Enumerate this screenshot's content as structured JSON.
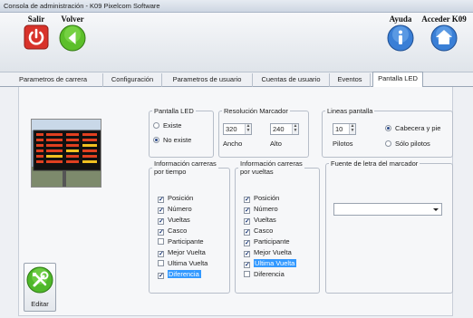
{
  "window": {
    "title": "Consola de administración - K09 Pixelcom Software"
  },
  "toolbar": {
    "salir": "Salir",
    "volver": "Volver",
    "ayuda": "Ayuda",
    "acceder": "Acceder K09"
  },
  "tabs": [
    {
      "label": "Parametros de carrera"
    },
    {
      "label": "Configuración"
    },
    {
      "label": "Parametros de usuario"
    },
    {
      "label": "Cuentas de usuario"
    },
    {
      "label": "Eventos"
    },
    {
      "label": "Pantalla LED",
      "active": true
    }
  ],
  "pantalla_led": {
    "legend": "Pantalla LED",
    "options": [
      "Existe",
      "No existe"
    ],
    "selected": "No existe"
  },
  "resolucion": {
    "legend": "Resolución Marcador",
    "ancho_value": "320",
    "alto_value": "240",
    "ancho_label": "Ancho",
    "alto_label": "Alto"
  },
  "lineas": {
    "legend": "Lineas pantalla",
    "value": "10",
    "pilotos_label": "Pilotos",
    "options": [
      "Cabecera y pie",
      "Sólo pilotos"
    ],
    "selected": "Cabecera y pie"
  },
  "info_tiempo": {
    "legend_line1": "Información carreras",
    "legend_line2": "por tiempo",
    "items": [
      {
        "label": "Posición",
        "checked": true
      },
      {
        "label": "Número",
        "checked": true
      },
      {
        "label": "Vueltas",
        "checked": true
      },
      {
        "label": "Casco",
        "checked": true
      },
      {
        "label": "Participante",
        "checked": false
      },
      {
        "label": "Mejor Vuelta",
        "checked": true
      },
      {
        "label": "Ultima Vuelta",
        "checked": false
      },
      {
        "label": "Diferencia",
        "checked": true,
        "selected": true
      }
    ]
  },
  "info_vueltas": {
    "legend_line1": "Información carreras",
    "legend_line2": "por vueltas",
    "items": [
      {
        "label": "Posición",
        "checked": true
      },
      {
        "label": "Número",
        "checked": true
      },
      {
        "label": "Vueltas",
        "checked": true
      },
      {
        "label": "Casco",
        "checked": true
      },
      {
        "label": "Participante",
        "checked": true
      },
      {
        "label": "Mejor Vuelta",
        "checked": true
      },
      {
        "label": "Ultima Vuelta",
        "checked": true,
        "selected": true
      },
      {
        "label": "Diferencia",
        "checked": false
      }
    ]
  },
  "fuente": {
    "legend": "Fuente de letra del marcador",
    "value": ""
  },
  "editar": {
    "label": "Editar"
  },
  "colors": {
    "salir_red": "#d8322a",
    "volver_green": "#5cbf2a",
    "info_blue": "#3a7fd6",
    "selection_blue": "#3399ff",
    "led_red": "#e04020",
    "led_yellow": "#f0c020"
  },
  "icons": {
    "salir": "power-icon",
    "volver": "back-arrow-icon",
    "ayuda": "info-icon",
    "acceder": "home-icon",
    "editar": "tools-icon"
  }
}
